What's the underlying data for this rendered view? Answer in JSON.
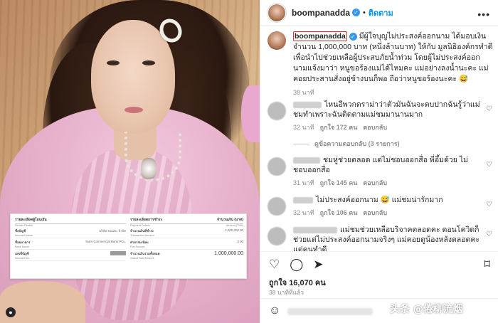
{
  "post_header": {
    "username": "boompanadda",
    "follow_label": "ติดตาม",
    "separator": "•",
    "more_icon": "more-horizontal-icon"
  },
  "caption": {
    "username": "boompanadda",
    "text": "มีผู้ใจบุญไม่ประสงค์ออกนาม ได้มอบเงินจำนวน 1,000,000 บาท (หนึ่งล้านบาท) ให้กับ มูลนิธิองค์กรทำดีเพื่อนำไปช่วยเหลือผู้ประสบภัยน้ำท่วม โดยผู้ไม่ประสงค์ออกนามแจ้งมาว่า หนูขอร้องแม่ได้ไหมคะ แม่อย่างลงน้ำนะคะ แม่คอยประสานสั่งอยู่ข้างบนก็พอ ถือว่าหนูขอร้องนะคะ 😅",
    "time": "38 นาที"
  },
  "comments": [
    {
      "text": "ไหนอีพวกดราม่าว่าตัวมันฉันจะตบปากฉันรู้ว่าแม่ชมทำเพราะฉันติดตามแม่ชมมานานมาก",
      "time": "32 นาที",
      "likes": "ถูกใจ 172 คน",
      "reply": "ตอบกลับ",
      "name_width": 40
    },
    {
      "text": "ชมหู่ช่วยตลอด แต่ไม่ชอบออกสื่อ พี่อึ้มด้วย ไม่ชอบออกสื่อ",
      "time": "31 นาที",
      "likes": "ถูกใจ 145 คน",
      "reply": "ตอบกลับ",
      "name_width": 38
    },
    {
      "text": "ไม่ประสงค์ออกนาม 😅 แม่ชมน่ารักมาก",
      "time": "32 นาที",
      "likes": "ถูกใจ 106 คน",
      "reply": "ตอบกลับ",
      "name_width": 28
    },
    {
      "text": "แม่ชมช่วยเหลือบริจาคตลอดคะ ตอนโควิดก็ช่วยแต่ไม่ประสงค์ออกนามจริงๆ แม่คอยดูน้องหลังตลอดคะ แต่คนทำดี",
      "name_width": 62
    }
  ],
  "view_replies": "ดูข้อความตอบกลับ (3 รายการ)",
  "actions": {
    "likes": "ถูกใจ 16,070 คน",
    "posted": "38 นาทีที่แล้ว"
  },
  "slip": {
    "sender_title": "รายละเอียดผู้โอนเงิน",
    "sender_sub": "Sender Details",
    "payment_title": "รายละเอียดการชำระ",
    "payment_sub": "Payment Details",
    "amount_head": "จำนวนเงิน (บาท)",
    "amount_sub": "Amount (THB)",
    "left_rows": [
      {
        "label": "ชื่อบัญชี",
        "sub": "Account Name",
        "value": "บริษัท ขอนพะ จำกัด"
      },
      {
        "label": "ชื่อธนาคาร",
        "sub": "Bank Name",
        "value": "Siam Commercial Bank PCL."
      },
      {
        "label": "เลขที่บัญชี",
        "sub": "Account No.",
        "value": ""
      }
    ],
    "right_rows": [
      {
        "label": "จำนวนเงินที่ชำระ",
        "sub": "Transaction Amount",
        "value": "1,000,000.00"
      },
      {
        "label": "ค่าธรรมเนียม",
        "sub": "Fee Amount",
        "value": "0.00"
      }
    ],
    "total_label": "จำนวนเงินรวมทั้งหมด",
    "total_sub": "Grand Total Amount",
    "total_value": "1,000,000.00"
  },
  "watermark": "头条 @倦柳流烟",
  "colors": {
    "link_blue": "#0095f6",
    "verified_blue": "#3897f0",
    "highlight_red": "#d0332f",
    "shirt_pink": "#e8b2cc"
  }
}
